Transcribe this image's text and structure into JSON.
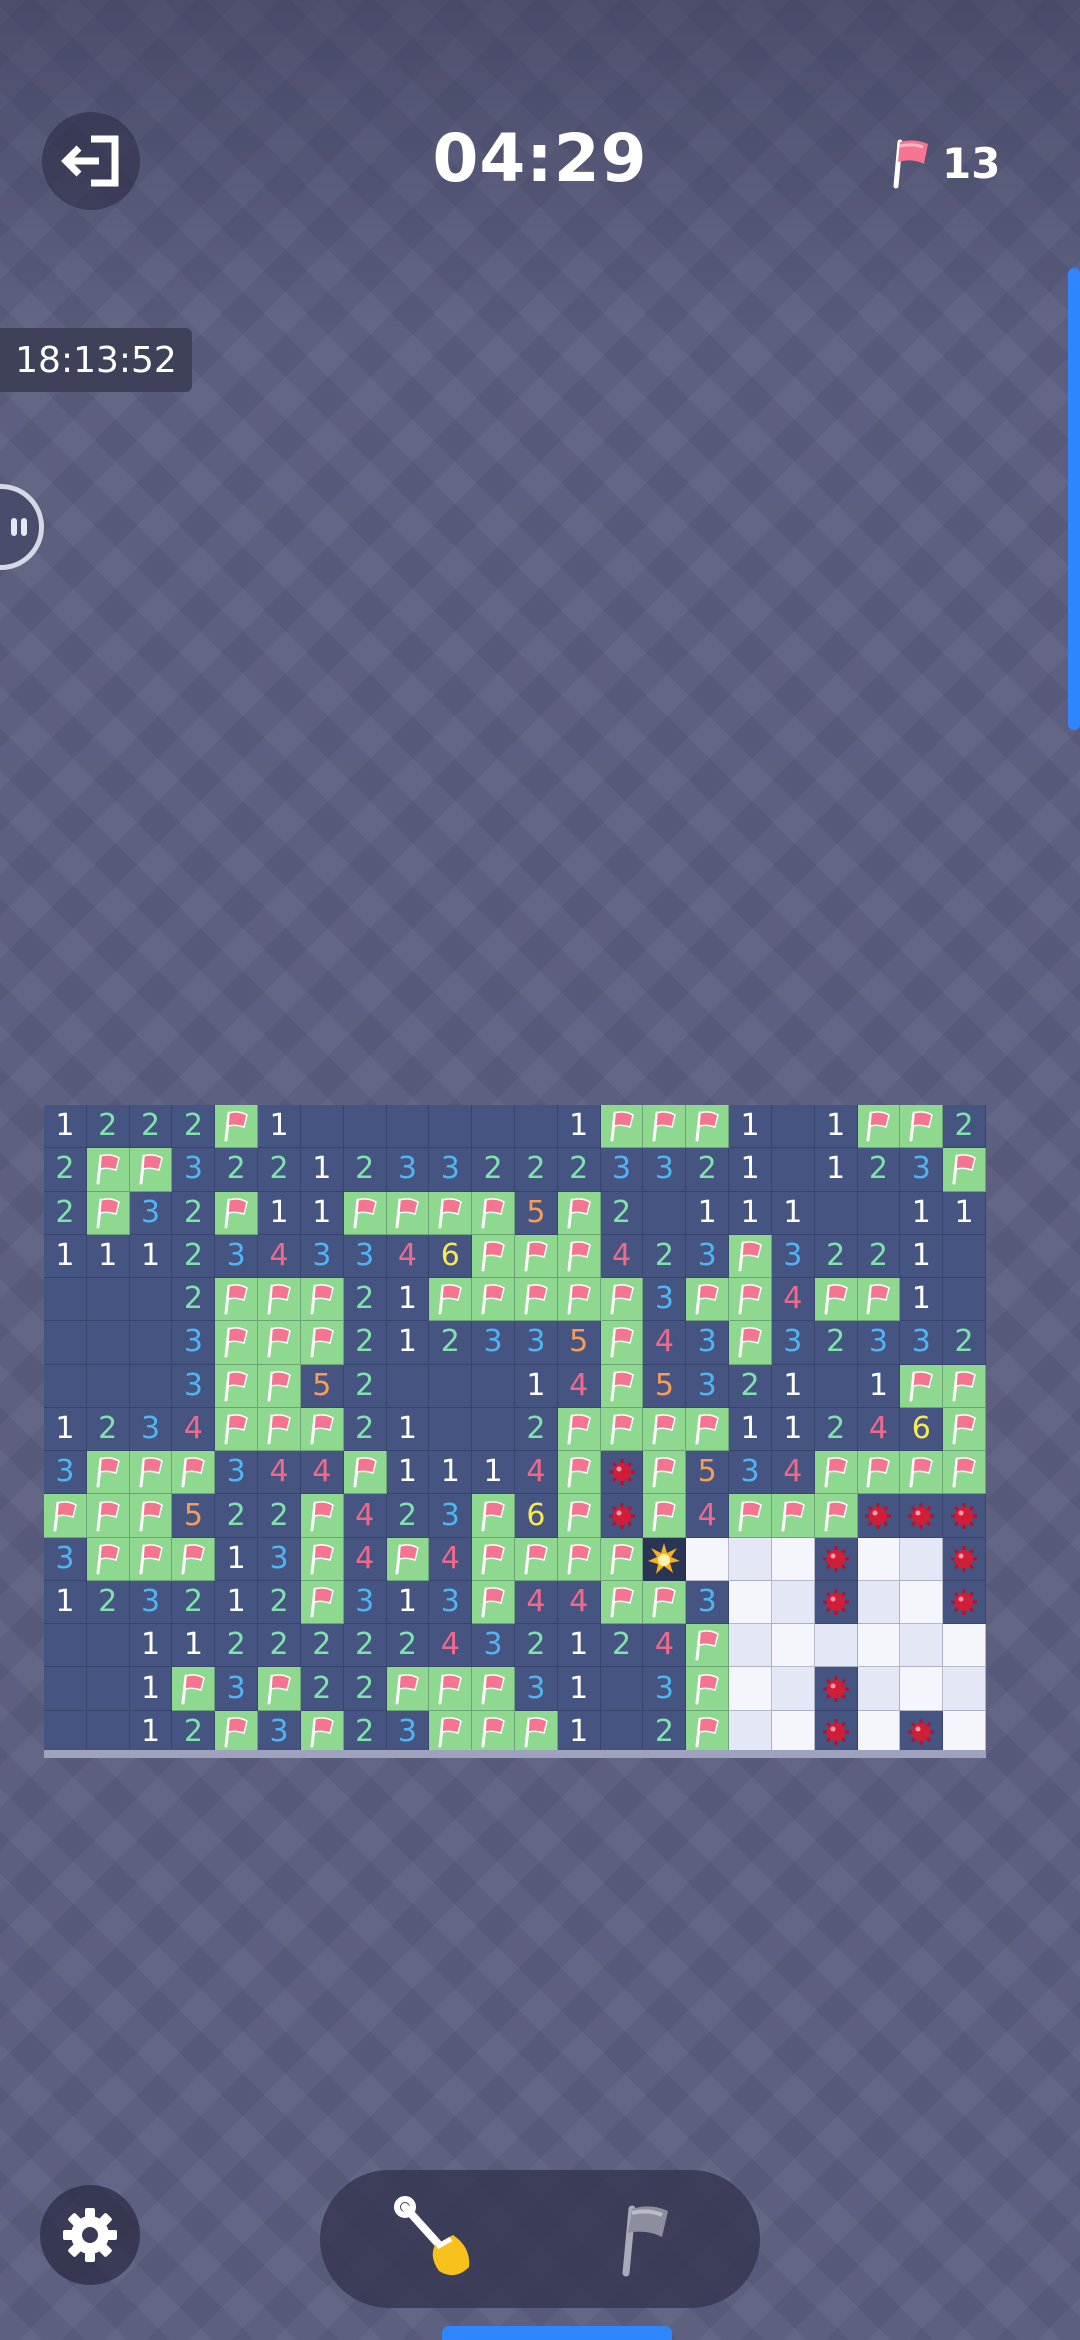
{
  "header": {
    "timer": "04:29",
    "flag_count": "13"
  },
  "status": {
    "clock": "18:13:52"
  },
  "icons": {
    "exit": "exit-icon",
    "flag": "flag-icon",
    "settings": "gear-icon",
    "dig": "shovel-icon",
    "mine": "mine-icon",
    "explosion": "explosion-icon"
  },
  "colors": {
    "board": "#465482",
    "flag_cell": "#8ed98f",
    "hidden_cell": "#e4e8f6",
    "accent": "#2f86ff",
    "n1": "#ffffff",
    "n2": "#7fe3ac",
    "n3": "#4fb4f2",
    "n4": "#f0688a",
    "n5": "#f89e54",
    "n6": "#f6ea52"
  },
  "board": {
    "cols": 22,
    "rows": [
      [
        "1",
        "2",
        "2",
        "2",
        "F",
        "1",
        "",
        "",
        "",
        "",
        "",
        "",
        "1",
        "F",
        "F",
        "F",
        "1",
        "",
        "1",
        "F",
        "F",
        "2"
      ],
      [
        "2",
        "F",
        "F",
        "3",
        "2",
        "2",
        "1",
        "2",
        "3",
        "3",
        "2",
        "2",
        "2",
        "3",
        "3",
        "2",
        "1",
        "",
        "1",
        "2",
        "3",
        "F"
      ],
      [
        "2",
        "F",
        "3",
        "2",
        "F",
        "1",
        "1",
        "F",
        "F",
        "F",
        "F",
        "5",
        "F",
        "2",
        "",
        "1",
        "1",
        "1",
        "",
        "",
        "1",
        "1"
      ],
      [
        "1",
        "1",
        "1",
        "2",
        "3",
        "4",
        "3",
        "3",
        "4",
        "6",
        "F",
        "F",
        "F",
        "4",
        "2",
        "3",
        "F",
        "3",
        "2",
        "2",
        "1",
        ""
      ],
      [
        "",
        "",
        "",
        "2",
        "F",
        "F",
        "F",
        "2",
        "1",
        "F",
        "F",
        "F",
        "F",
        "F",
        "3",
        "F",
        "F",
        "4",
        "F",
        "F",
        "1",
        ""
      ],
      [
        "",
        "",
        "",
        "3",
        "F",
        "F",
        "F",
        "2",
        "1",
        "2",
        "3",
        "3",
        "5",
        "F",
        "4",
        "3",
        "F",
        "3",
        "2",
        "3",
        "3",
        "2"
      ],
      [
        "",
        "",
        "",
        "3",
        "F",
        "F",
        "5",
        "2",
        "",
        "",
        "",
        "1",
        "4",
        "F",
        "5",
        "3",
        "2",
        "1",
        "",
        "1",
        "F",
        "F"
      ],
      [
        "1",
        "2",
        "3",
        "4",
        "F",
        "F",
        "F",
        "2",
        "1",
        "",
        "",
        "2",
        "F",
        "F",
        "F",
        "F",
        "1",
        "1",
        "2",
        "4",
        "6",
        "F"
      ],
      [
        "3",
        "F",
        "F",
        "F",
        "3",
        "4",
        "4",
        "F",
        "1",
        "1",
        "1",
        "4",
        "F",
        "M",
        "F",
        "5",
        "3",
        "4",
        "F",
        "F",
        "F",
        "F"
      ],
      [
        "F",
        "F",
        "F",
        "5",
        "2",
        "2",
        "F",
        "4",
        "2",
        "3",
        "F",
        "6",
        "F",
        "M",
        "F",
        "4",
        "F",
        "F",
        "F",
        "M",
        "M",
        "M"
      ],
      [
        "3",
        "F",
        "F",
        "F",
        "1",
        "3",
        "F",
        "4",
        "F",
        "4",
        "F",
        "F",
        "F",
        "F",
        "X",
        "H",
        "H",
        "H",
        "M",
        "H",
        "H",
        "M"
      ],
      [
        "1",
        "2",
        "3",
        "2",
        "1",
        "2",
        "F",
        "3",
        "1",
        "3",
        "F",
        "4",
        "4",
        "F",
        "F",
        "3",
        "H",
        "H",
        "M",
        "H",
        "H",
        "M"
      ],
      [
        "",
        "",
        "1",
        "1",
        "2",
        "2",
        "2",
        "2",
        "2",
        "4",
        "3",
        "2",
        "1",
        "2",
        "4",
        "F",
        "H",
        "H",
        "H",
        "H",
        "H",
        "H"
      ],
      [
        "",
        "",
        "1",
        "F",
        "3",
        "F",
        "2",
        "2",
        "F",
        "F",
        "F",
        "3",
        "1",
        "",
        "3",
        "F",
        "H",
        "H",
        "M",
        "H",
        "H",
        "H"
      ],
      [
        "",
        "",
        "1",
        "2",
        "F",
        "3",
        "F",
        "2",
        "3",
        "F",
        "F",
        "F",
        "1",
        "",
        "2",
        "F",
        "H",
        "H",
        "M",
        "H",
        "M",
        "H"
      ]
    ]
  }
}
